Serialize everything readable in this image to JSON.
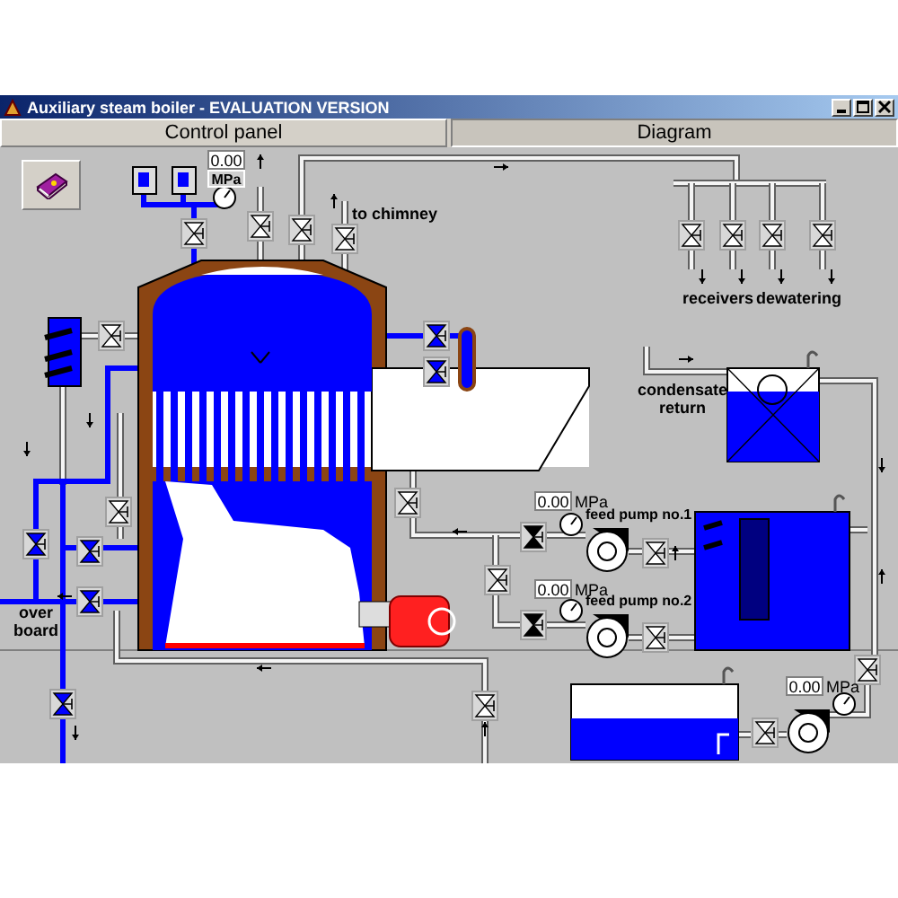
{
  "window": {
    "title": "Auxiliary steam boiler - EVALUATION VERSION"
  },
  "tabs": [
    {
      "label": "Control panel",
      "selected": false
    },
    {
      "label": "Diagram",
      "selected": true
    }
  ],
  "diagram": {
    "labels": [
      "to chimney",
      "receivers",
      "dewatering",
      "condensate return",
      "feed pump no.1",
      "feed pump no.2",
      "over board"
    ],
    "gauges": [
      {
        "reading": "0.00",
        "unit": "MPa"
      },
      {
        "reading": "0.00",
        "unit": "MPa"
      },
      {
        "reading": "0.00",
        "unit": "MPa"
      },
      {
        "reading": "0.00",
        "unit": "MPa"
      }
    ]
  }
}
